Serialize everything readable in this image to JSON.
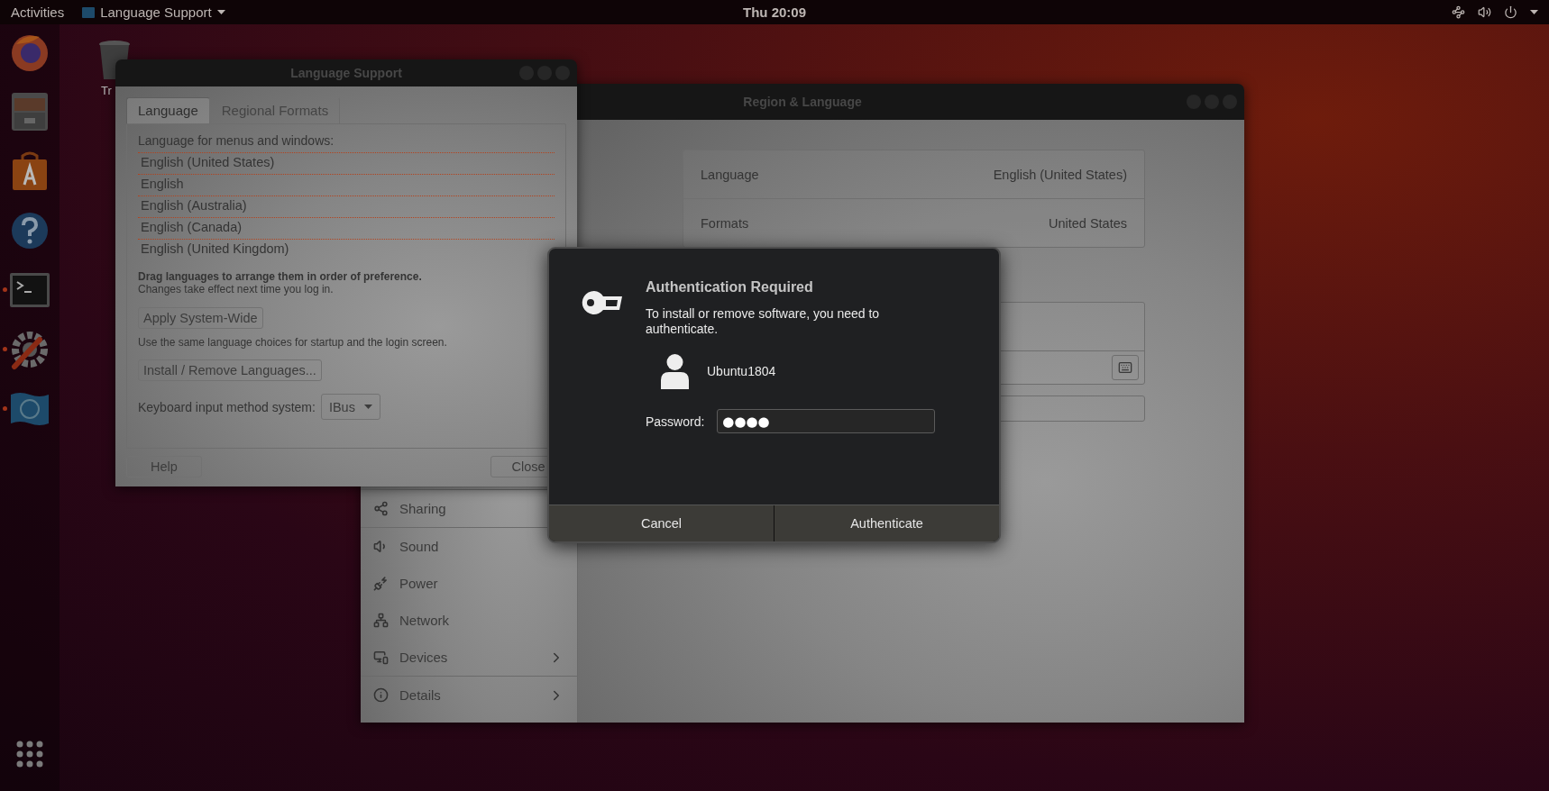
{
  "top_bar": {
    "activities": "Activities",
    "app_menu": "Language Support",
    "clock": "Thu 20:09"
  },
  "dock": {
    "items": [
      {
        "kind": "browser",
        "running": false
      },
      {
        "kind": "files",
        "running": false
      },
      {
        "kind": "software",
        "running": false
      },
      {
        "kind": "help",
        "running": false
      },
      {
        "kind": "terminal",
        "running": true
      },
      {
        "kind": "tools",
        "running": true
      },
      {
        "kind": "flag",
        "running": true
      }
    ]
  },
  "desktop_icons": [
    {
      "label": "Tr"
    }
  ],
  "region_language": {
    "title": "Region & Language",
    "settings": [
      {
        "label": "Language",
        "value": "English (United States)"
      },
      {
        "label": "Formats",
        "value": "United States"
      }
    ],
    "sidebar": [
      [
        {
          "label": "Sharing",
          "kind": "share"
        }
      ],
      [
        {
          "label": "Sound",
          "kind": "sound"
        },
        {
          "label": "Power",
          "kind": "power"
        },
        {
          "label": "Network",
          "kind": "network"
        },
        {
          "label": "Devices",
          "kind": "devices"
        }
      ],
      [
        {
          "label": "Details",
          "kind": "details"
        }
      ]
    ]
  },
  "language_support": {
    "title": "Language Support",
    "tabs": [
      {
        "label": "Language",
        "selected": true
      },
      {
        "label": "Regional Formats",
        "selected": false
      }
    ],
    "list_label": "Language for menus and windows:",
    "languages": [
      "English (United States)",
      "English",
      "English (Australia)",
      "English (Canada)",
      "English (United Kingdom)"
    ],
    "drag_hint": "Drag languages to arrange them in order of preference.",
    "effect_hint": "Changes take effect next time you log in.",
    "apply_button": "Apply System-Wide",
    "apply_hint": "Use the same language choices for startup and the login screen.",
    "install_button": "Install / Remove Languages...",
    "input_method_label": "Keyboard input method system:",
    "input_method": "IBus",
    "help_button": "Help",
    "close_button": "Close"
  },
  "auth_dialog": {
    "title": "Authentication Required",
    "message": "To install or remove software, you need to authenticate.",
    "user": "Ubuntu1804",
    "password_label": "Password:",
    "password": "●●●●",
    "buttons": [
      "Cancel",
      "Authenticate"
    ]
  }
}
